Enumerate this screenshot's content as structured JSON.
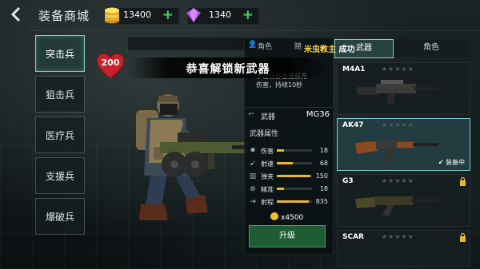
{
  "header": {
    "title": "装备商城",
    "coins": "13400",
    "gems": "1340",
    "plus": "+"
  },
  "classes": [
    {
      "label": "突击兵"
    },
    {
      "label": "狙击兵"
    },
    {
      "label": "医疗兵"
    },
    {
      "label": "支援兵"
    },
    {
      "label": "爆破兵"
    }
  ],
  "health": "200",
  "banner": "恭喜解锁新武器",
  "toast": {
    "user": "米虫教主",
    "suffix": "成功"
  },
  "info_panel": {
    "tab_left": "角色",
    "tab_right": "随",
    "desc_line1": "掌击防御塞推前方",
    "desc_line2": "伤害，持续10秒",
    "weapon_label": "武器",
    "weapon_name": "MG36",
    "attrs_title": "武器属性",
    "stats": [
      {
        "name": "伤害",
        "value": "18",
        "level": 0.2
      },
      {
        "name": "射速",
        "value": "68",
        "level": 0.45
      },
      {
        "name": "弹夹",
        "value": "150",
        "level": 0.95
      },
      {
        "name": "精准",
        "value": "18",
        "level": 0.2
      },
      {
        "name": "射程",
        "value": "835",
        "level": 0.9
      }
    ],
    "price": "x4500",
    "upgrade": "升级"
  },
  "weapon_tabs": {
    "weapons": "武器",
    "role": "角色"
  },
  "weapons": [
    {
      "name": "M4A1",
      "stars": "★★★★★",
      "equipped": "",
      "locked": false,
      "selected": false
    },
    {
      "name": "AK47",
      "stars": "★★★★★",
      "equipped": "✔ 装备中",
      "locked": false,
      "selected": true
    },
    {
      "name": "G3",
      "stars": "★★★★★",
      "equipped": "",
      "locked": true,
      "selected": false
    },
    {
      "name": "SCAR",
      "stars": "★★★★★",
      "equipped": "",
      "locked": true,
      "selected": false
    }
  ],
  "colors": {
    "accent": "#7fd1c1",
    "upgrade": "#1f5b33",
    "coin": "#f2c12e",
    "gem": "#b24ee6",
    "plus": "#3fd66a"
  }
}
